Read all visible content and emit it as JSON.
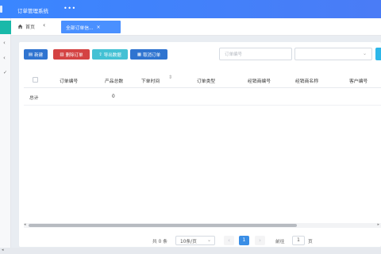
{
  "header": {
    "title": "订单管理系统",
    "more": "•••"
  },
  "tabs": {
    "home_label": "首页",
    "back": "‹",
    "active_label": "全部订单信...",
    "active_close": "×"
  },
  "sidebar": {
    "chevrons": [
      "‹",
      "‹",
      "✓"
    ]
  },
  "toolbar": {
    "new_label": "新建",
    "delete_label": "删除订单",
    "export_label": "导出数据",
    "cancel_label": "取消订单",
    "search_placeholder": "订单编号",
    "select_value": ""
  },
  "table": {
    "columns": [
      "订单编号",
      "产品总数",
      "下单时间",
      "订单类型",
      "经销商编号",
      "经销商名称",
      "客户编号"
    ],
    "total_label": "总计",
    "total_product_count": "0",
    "rows": []
  },
  "scroll": {
    "left_arrow": "◂",
    "right_arrow": "▸"
  },
  "pagination": {
    "total_text": "共 0 条",
    "page_size": "10条/页",
    "prev": "‹",
    "current_page": "1",
    "next": "›",
    "goto_label": "前往",
    "goto_value": "1",
    "page_suffix": "页"
  },
  "colors": {
    "header": "#4a7cf6",
    "primary": "#2f74d0",
    "danger": "#d44343",
    "info": "#44c1d4",
    "active_tab": "#4a90ff",
    "sidebar_accent": "#19b9a9"
  }
}
